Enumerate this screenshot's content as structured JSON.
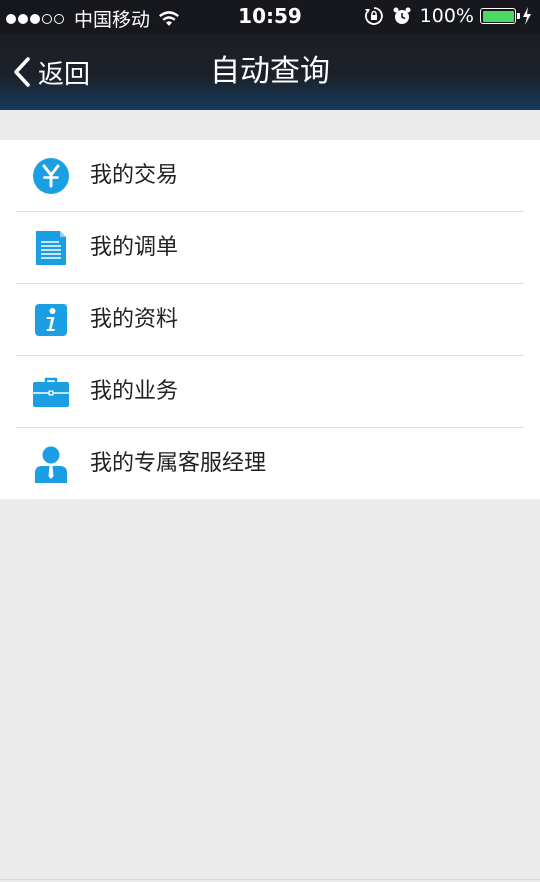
{
  "status_bar": {
    "carrier": "中国移动",
    "time": "10:59",
    "battery_percent": "100%",
    "signal_full_dots": 3,
    "signal_total_dots": 5,
    "battery_level": 1.0,
    "battery_color": "#4cd964"
  },
  "nav": {
    "back_label": "返回",
    "title": "自动查询",
    "back_icon": "chevron-left-icon"
  },
  "menu": {
    "icon_color": "#1b9ee4",
    "items": [
      {
        "label": "我的交易",
        "icon": "yen-icon"
      },
      {
        "label": "我的调单",
        "icon": "document-icon"
      },
      {
        "label": "我的资料",
        "icon": "info-icon"
      },
      {
        "label": "我的业务",
        "icon": "briefcase-icon"
      },
      {
        "label": "我的专属客服经理",
        "icon": "person-icon"
      }
    ]
  }
}
